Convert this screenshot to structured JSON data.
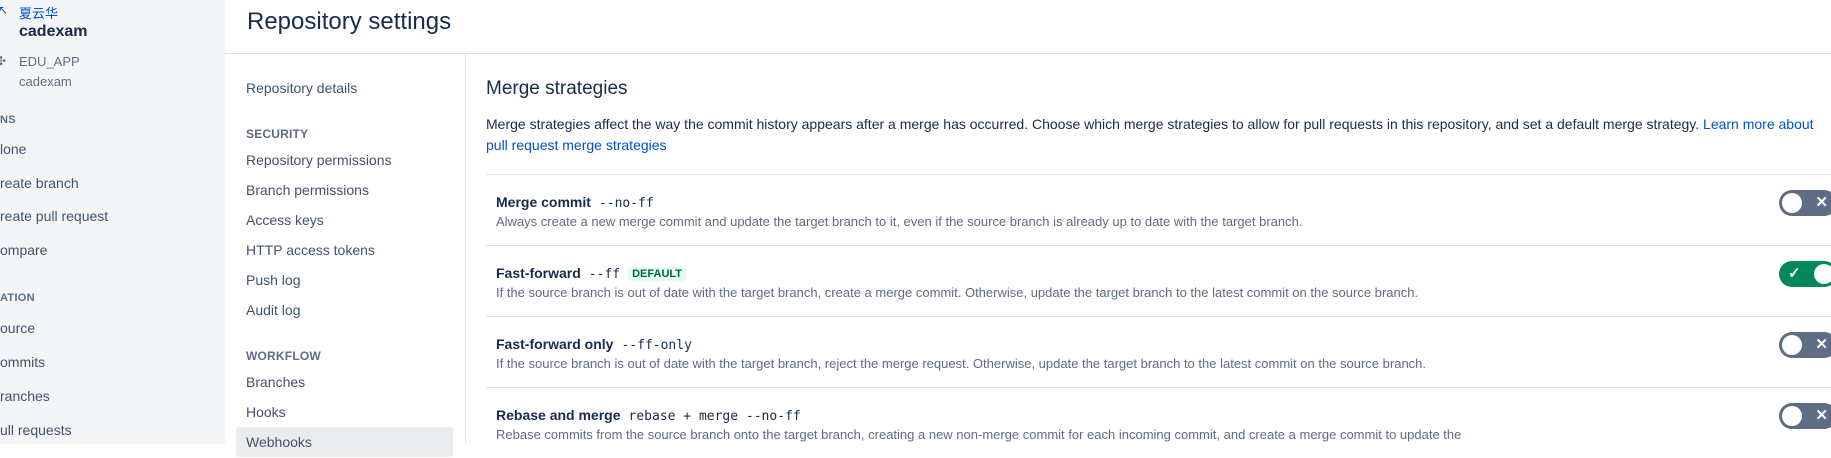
{
  "global_sidebar": {
    "user": "夏云华",
    "project": "cadexam",
    "repo_name": "EDU_APP",
    "repo_project": "cadexam",
    "actions_heading": "NS",
    "actions": [
      "lone",
      "reate branch",
      "reate pull request",
      "ompare"
    ],
    "navigation_heading": "ATION",
    "navigation": [
      "ource",
      "ommits",
      "ranches",
      "ull requests"
    ]
  },
  "page": {
    "title": "Repository settings"
  },
  "settings_nav": {
    "details": "Repository details",
    "security_heading": "SECURITY",
    "security_items": [
      "Repository permissions",
      "Branch permissions",
      "Access keys",
      "HTTP access tokens",
      "Push log",
      "Audit log"
    ],
    "workflow_heading": "WORKFLOW",
    "workflow_items": [
      "Branches",
      "Hooks",
      "Webhooks"
    ]
  },
  "merge": {
    "title": "Merge strategies",
    "description": "Merge strategies affect the way the commit history appears after a merge has occurred. Choose which merge strategies to allow for pull requests in this repository, and set a default merge strategy.",
    "learn_more": "Learn more about pull request merge strategies",
    "strategies": [
      {
        "name": "Merge commit",
        "command": "--no-ff",
        "badge": "",
        "description": "Always create a new merge commit and update the target branch to it, even if the source branch is already up to date with the target branch.",
        "enabled": false
      },
      {
        "name": "Fast-forward",
        "command": "--ff",
        "badge": "DEFAULT",
        "description": "If the source branch is out of date with the target branch, create a merge commit. Otherwise, update the target branch to the latest commit on the source branch.",
        "enabled": true
      },
      {
        "name": "Fast-forward only",
        "command": "--ff-only",
        "badge": "",
        "description": "If the source branch is out of date with the target branch, reject the merge request. Otherwise, update the target branch to the latest commit on the source branch.",
        "enabled": false
      },
      {
        "name": "Rebase and merge",
        "command": "rebase + merge --no-ff",
        "badge": "",
        "description": "Rebase commits from the source branch onto the target branch, creating a new non-merge commit for each incoming commit, and create a merge commit to update the",
        "enabled": false
      }
    ]
  },
  "colors": {
    "toggle_on": "#00875a",
    "toggle_off": "#5e6c84",
    "link": "#0052cc",
    "badge_text": "#006644",
    "badge_bg": "#e3fcef"
  },
  "icons": {
    "toggle_on": "check-icon",
    "toggle_off": "close-icon"
  }
}
